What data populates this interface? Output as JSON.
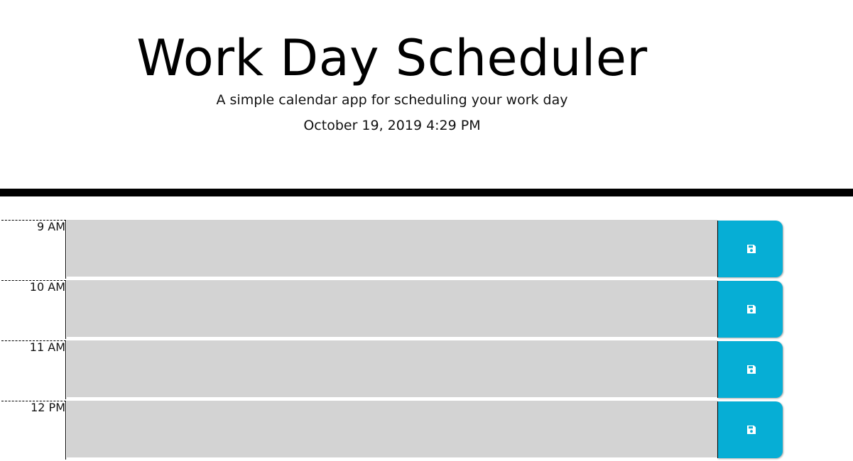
{
  "header": {
    "title": "Work Day Scheduler",
    "subtitle": "A simple calendar app for scheduling your work day",
    "current_datetime": "October 19, 2019 4:29 PM"
  },
  "timeblocks": [
    {
      "hour": "9 AM",
      "description": "",
      "save_icon": "save-icon"
    },
    {
      "hour": "10 AM",
      "description": "",
      "save_icon": "save-icon"
    },
    {
      "hour": "11 AM",
      "description": "",
      "save_icon": "save-icon"
    },
    {
      "hour": "12 PM",
      "description": "",
      "save_icon": "save-icon"
    }
  ],
  "colors": {
    "block_background": "#d3d3d3",
    "save_button": "#06aed5",
    "divider": "#000000",
    "text": "#000000"
  }
}
